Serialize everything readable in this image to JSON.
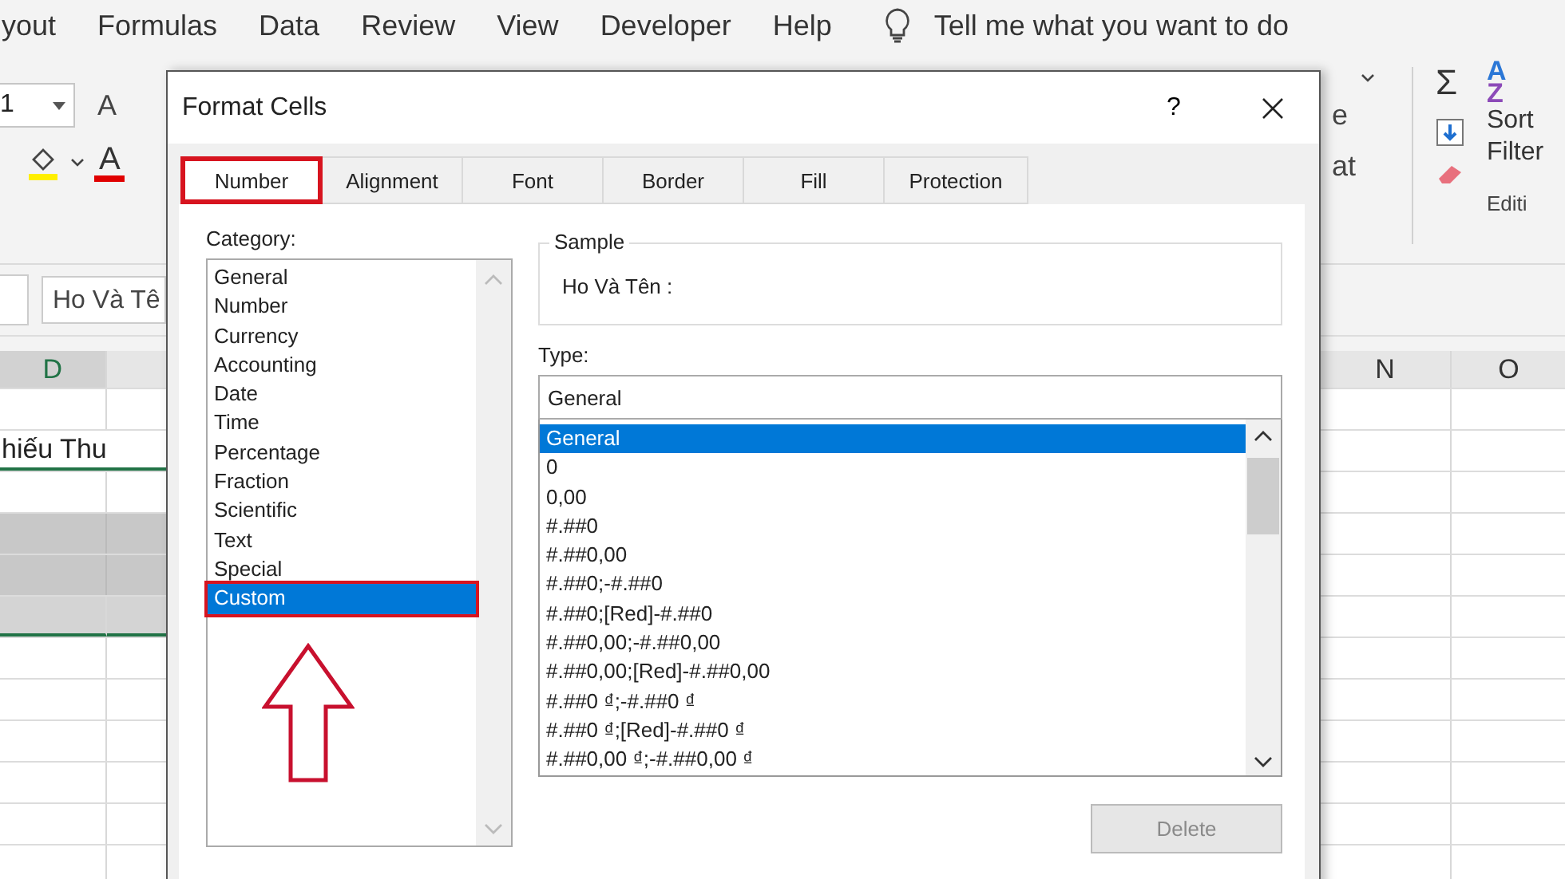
{
  "ribbon_tabs": [
    "yout",
    "Formulas",
    "Data",
    "Review",
    "View",
    "Developer",
    "Help"
  ],
  "tell_me": "Tell me what you want to do",
  "ribbon": {
    "font_size": "1",
    "grow_font": "A",
    "font_color": "A",
    "right_fragments": [
      "e",
      "at"
    ],
    "sum": "Σ",
    "sort_letters": [
      "A",
      "Z"
    ],
    "sort_label": "Sort",
    "filter_label": "Filter",
    "group_label": "Editi"
  },
  "formula_bar": {
    "value": "Ho Và Tê"
  },
  "sheet": {
    "columns": [
      "D",
      "N",
      "O"
    ],
    "cell_text": "hiếu Thu"
  },
  "dialog": {
    "title": "Format Cells",
    "help": "?",
    "tabs": [
      {
        "label": "Number",
        "selected": true,
        "highlighted": true
      },
      {
        "label": "Alignment",
        "selected": false,
        "highlighted": false
      },
      {
        "label": "Font",
        "selected": false,
        "highlighted": false
      },
      {
        "label": "Border",
        "selected": false,
        "highlighted": false
      },
      {
        "label": "Fill",
        "selected": false,
        "highlighted": false
      },
      {
        "label": "Protection",
        "selected": false,
        "highlighted": false
      }
    ],
    "category_label": "Category:",
    "categories": [
      {
        "label": "General",
        "selected": false,
        "highlighted": false
      },
      {
        "label": "Number",
        "selected": false,
        "highlighted": false
      },
      {
        "label": "Currency",
        "selected": false,
        "highlighted": false
      },
      {
        "label": "Accounting",
        "selected": false,
        "highlighted": false
      },
      {
        "label": "Date",
        "selected": false,
        "highlighted": false
      },
      {
        "label": "Time",
        "selected": false,
        "highlighted": false
      },
      {
        "label": "Percentage",
        "selected": false,
        "highlighted": false
      },
      {
        "label": "Fraction",
        "selected": false,
        "highlighted": false
      },
      {
        "label": "Scientific",
        "selected": false,
        "highlighted": false
      },
      {
        "label": "Text",
        "selected": false,
        "highlighted": false
      },
      {
        "label": "Special",
        "selected": false,
        "highlighted": false
      },
      {
        "label": "Custom",
        "selected": true,
        "highlighted": true
      }
    ],
    "sample": {
      "legend": "Sample",
      "value": "Ho Và Tên :"
    },
    "type_label": "Type:",
    "type_value": "General",
    "types": [
      {
        "label": "General",
        "selected": true
      },
      {
        "label": "0",
        "selected": false
      },
      {
        "label": "0,00",
        "selected": false
      },
      {
        "label": "#.##0",
        "selected": false
      },
      {
        "label": "#.##0,00",
        "selected": false
      },
      {
        "label": "#.##0;-#.##0",
        "selected": false
      },
      {
        "label": "#.##0;[Red]-#.##0",
        "selected": false
      },
      {
        "label": "#.##0,00;-#.##0,00",
        "selected": false
      },
      {
        "label": "#.##0,00;[Red]-#.##0,00",
        "selected": false
      },
      {
        "label": "#.##0 ₫;-#.##0 ₫",
        "selected": false
      },
      {
        "label": "#.##0 ₫;[Red]-#.##0 ₫",
        "selected": false
      },
      {
        "label": "#.##0,00 ₫;-#.##0,00 ₫",
        "selected": false
      }
    ],
    "delete_button": {
      "label": "Delete",
      "disabled": true
    }
  }
}
